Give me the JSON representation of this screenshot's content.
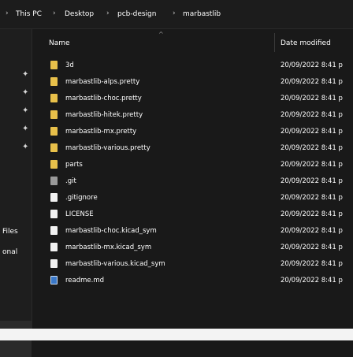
{
  "breadcrumb": {
    "items": [
      "This PC",
      "Desktop",
      "pcb-design",
      "marbastlib"
    ],
    "separator": "›"
  },
  "nav": {
    "pins": [
      "✦",
      "✦",
      "✦",
      "✦",
      "✦"
    ],
    "items": [
      "Files",
      "onal"
    ]
  },
  "columns": {
    "name": "Name",
    "date_modified": "Date modified",
    "sort_caret": "^"
  },
  "files": [
    {
      "name": "3d",
      "date": "20/09/2022 8:41 p",
      "icon": "folder-icon"
    },
    {
      "name": "marbastlib-alps.pretty",
      "date": "20/09/2022 8:41 p",
      "icon": "folder-icon"
    },
    {
      "name": "marbastlib-choc.pretty",
      "date": "20/09/2022 8:41 p",
      "icon": "folder-icon"
    },
    {
      "name": "marbastlib-hitek.pretty",
      "date": "20/09/2022 8:41 p",
      "icon": "folder-icon"
    },
    {
      "name": "marbastlib-mx.pretty",
      "date": "20/09/2022 8:41 p",
      "icon": "folder-icon"
    },
    {
      "name": "marbastlib-various.pretty",
      "date": "20/09/2022 8:41 p",
      "icon": "folder-icon"
    },
    {
      "name": "parts",
      "date": "20/09/2022 8:41 p",
      "icon": "folder-icon"
    },
    {
      "name": ".git",
      "date": "20/09/2022 8:41 p",
      "icon": "hidden-file-icon"
    },
    {
      "name": ".gitignore",
      "date": "20/09/2022 8:41 p",
      "icon": "file-icon"
    },
    {
      "name": "LICENSE",
      "date": "20/09/2022 8:41 p",
      "icon": "file-icon"
    },
    {
      "name": "marbastlib-choc.kicad_sym",
      "date": "20/09/2022 8:41 p",
      "icon": "file-icon"
    },
    {
      "name": "marbastlib-mx.kicad_sym",
      "date": "20/09/2022 8:41 p",
      "icon": "file-icon"
    },
    {
      "name": "marbastlib-various.kicad_sym",
      "date": "20/09/2022 8:41 p",
      "icon": "file-icon"
    },
    {
      "name": "readme.md",
      "date": "20/09/2022 8:41 p",
      "icon": "markdown-file-icon"
    }
  ],
  "colors": {
    "background": "#191919",
    "folder": "#e8c04a",
    "text": "#ffffff"
  }
}
